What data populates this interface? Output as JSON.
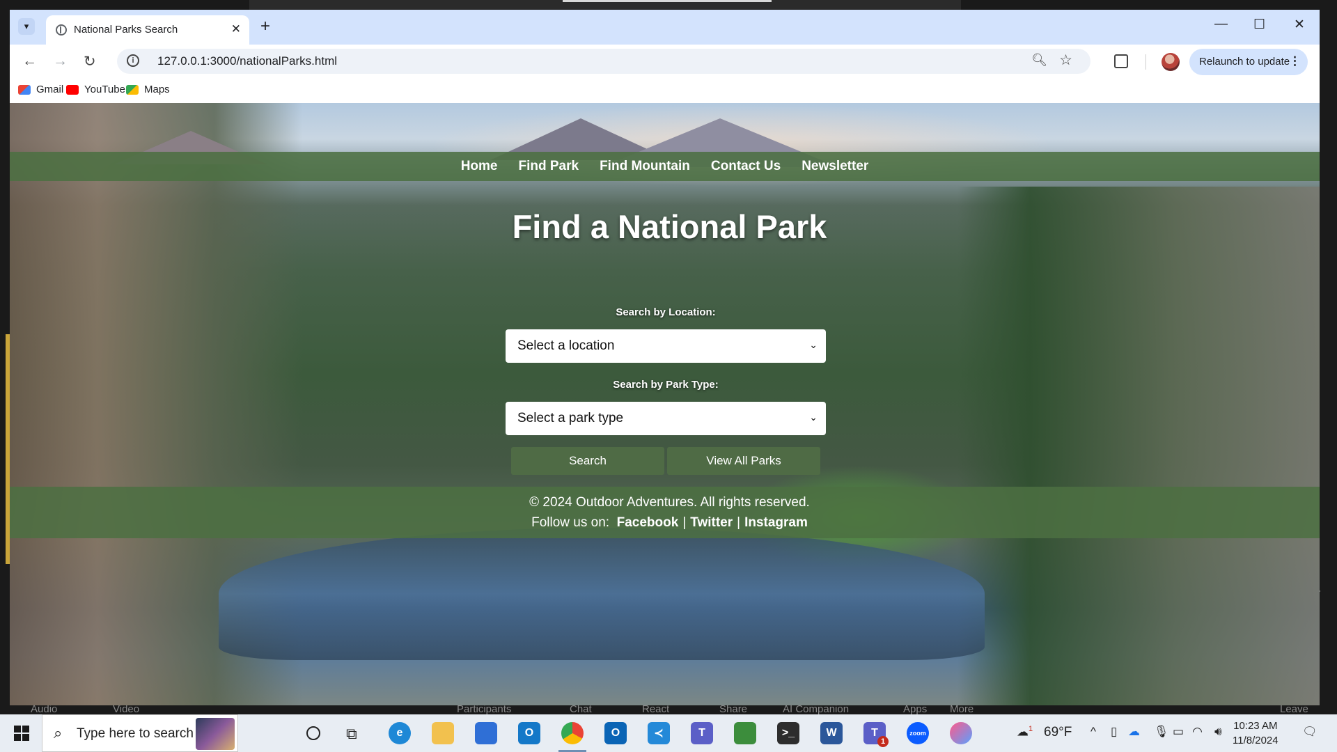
{
  "browser": {
    "tab_title": "National Parks Search",
    "url": "127.0.0.1:3000/nationalParks.html",
    "relaunch_label": "Relaunch to update",
    "bookmarks": [
      "Gmail",
      "YouTube",
      "Maps"
    ]
  },
  "nav": {
    "items": [
      "Home",
      "Find Park",
      "Find Mountain",
      "Contact Us",
      "Newsletter"
    ]
  },
  "main": {
    "title": "Find a National Park",
    "location_label": "Search by Location:",
    "location_selected": "Select a location",
    "park_type_label": "Search by Park Type:",
    "park_type_selected": "Select a park type",
    "search_button": "Search",
    "view_all_button": "View All Parks"
  },
  "footer": {
    "copyright": "© 2024 Outdoor Adventures. All rights reserved.",
    "follow_label": "Follow us on:",
    "links": [
      "Facebook",
      "Twitter",
      "Instagram"
    ]
  },
  "meeting_bar": [
    "Audio",
    "Video",
    "Participants",
    "Chat",
    "React",
    "Share",
    "AI Companion",
    "Apps",
    "More",
    "Leave"
  ],
  "taskbar": {
    "search_placeholder": "Type here to search",
    "weather": "69°F",
    "time": "10:23 AM",
    "date": "11/8/2024",
    "weather_badge": "1",
    "teams_badge": "1"
  },
  "colors": {
    "nav_green": "#4c7042",
    "button_green": "#4f6b45",
    "tabstrip": "#d3e3fd"
  }
}
